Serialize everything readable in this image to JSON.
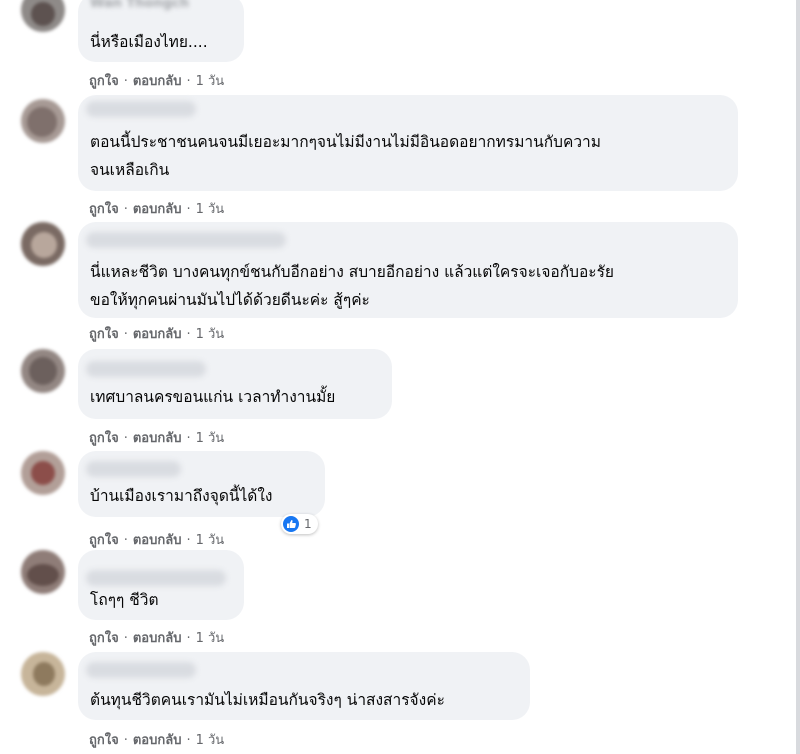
{
  "actions": {
    "like": "ถูกใจ",
    "reply": "ตอบกลับ",
    "separator": "·"
  },
  "comments": [
    {
      "author": "Wan Thongch",
      "text": "นี่หรือเมืองไทย....",
      "age": "1 วัน"
    },
    {
      "author": "",
      "text": "ตอนนี้ประชาชนคนจนมีเยอะมากๆจนไม่มีงานไม่มีอินอดอยากทรมานกับความ\nจนเหลือเกิน",
      "age": "1 วัน"
    },
    {
      "author": "",
      "text": "นี่แหละชีวิต บางคนทุกข์ชนกับอีกอย่าง สบายอีกอย่าง แล้วแต่ใครจะเจอกับอะรัย\nขอให้ทุกคนผ่านมันไปได้ด้วยดีนะค่ะ สู้ๆค่ะ",
      "age": "1 วัน"
    },
    {
      "author": "",
      "text": "เทศบาลนครขอนแก่น เวลาทำงานมั้ย",
      "age": "1 วัน"
    },
    {
      "author": "",
      "text": "บ้านเมืองเรามาถึงจุดนี้ได้ใง",
      "age": "1 วัน",
      "reaction_count": "1"
    },
    {
      "author": "",
      "text": "โถๆๆ ชีวิต",
      "age": "1 วัน"
    },
    {
      "author": "",
      "text": "ต้นทุนชีวิตคนเรามันไม่เหมือนกันจริงๆ น่าสงสารจังค่ะ",
      "age": "1 วัน"
    }
  ]
}
